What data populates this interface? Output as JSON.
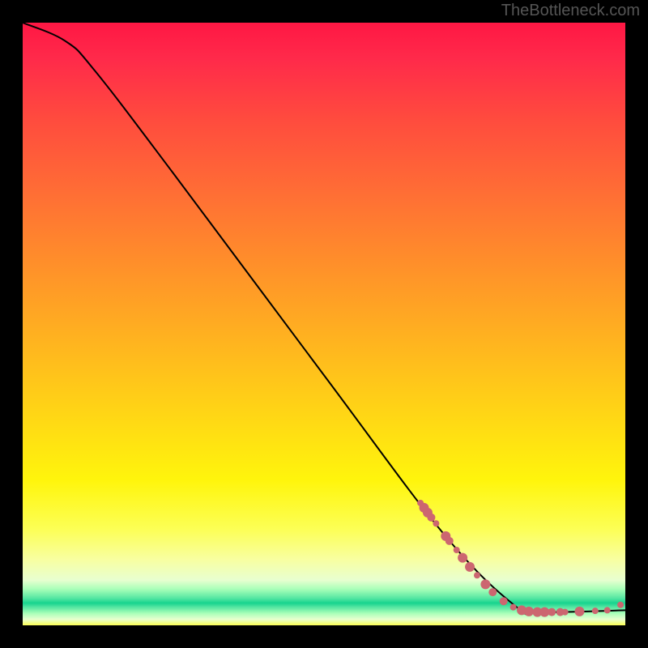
{
  "attribution": "TheBottleneck.com",
  "chart_data": {
    "type": "line",
    "title": "",
    "xlabel": "",
    "ylabel": "",
    "xlim": [
      0,
      100
    ],
    "ylim": [
      0,
      100
    ],
    "curve": [
      {
        "x": 0,
        "y": 100
      },
      {
        "x": 7,
        "y": 97
      },
      {
        "x": 12,
        "y": 92
      },
      {
        "x": 25,
        "y": 75
      },
      {
        "x": 50,
        "y": 41.5
      },
      {
        "x": 70,
        "y": 15
      },
      {
        "x": 82,
        "y": 3
      },
      {
        "x": 86,
        "y": 2.2
      },
      {
        "x": 100,
        "y": 2.5
      }
    ],
    "markers": [
      {
        "x": 66.0,
        "y": 20.3,
        "r": 4
      },
      {
        "x": 66.6,
        "y": 19.5,
        "r": 6
      },
      {
        "x": 67.2,
        "y": 18.7,
        "r": 6
      },
      {
        "x": 67.8,
        "y": 17.9,
        "r": 5
      },
      {
        "x": 68.6,
        "y": 16.9,
        "r": 4
      },
      {
        "x": 70.2,
        "y": 14.8,
        "r": 6
      },
      {
        "x": 70.8,
        "y": 14.0,
        "r": 5
      },
      {
        "x": 72.0,
        "y": 12.5,
        "r": 4
      },
      {
        "x": 73.0,
        "y": 11.2,
        "r": 6
      },
      {
        "x": 74.2,
        "y": 9.7,
        "r": 6
      },
      {
        "x": 75.4,
        "y": 8.3,
        "r": 4
      },
      {
        "x": 76.8,
        "y": 6.8,
        "r": 6
      },
      {
        "x": 78.0,
        "y": 5.5,
        "r": 5
      },
      {
        "x": 79.8,
        "y": 4.0,
        "r": 5
      },
      {
        "x": 81.4,
        "y": 3.0,
        "r": 4
      },
      {
        "x": 82.8,
        "y": 2.5,
        "r": 6
      },
      {
        "x": 84.0,
        "y": 2.3,
        "r": 6
      },
      {
        "x": 85.4,
        "y": 2.2,
        "r": 6
      },
      {
        "x": 86.6,
        "y": 2.2,
        "r": 6
      },
      {
        "x": 87.8,
        "y": 2.2,
        "r": 5
      },
      {
        "x": 89.2,
        "y": 2.2,
        "r": 5
      },
      {
        "x": 90.0,
        "y": 2.2,
        "r": 4
      },
      {
        "x": 92.4,
        "y": 2.3,
        "r": 6
      },
      {
        "x": 95.0,
        "y": 2.4,
        "r": 4
      },
      {
        "x": 97.0,
        "y": 2.5,
        "r": 4
      },
      {
        "x": 99.2,
        "y": 3.4,
        "r": 4
      }
    ],
    "background": {
      "type": "vertical-gradient",
      "stops": [
        {
          "pos": 0.0,
          "color": "#ff1744"
        },
        {
          "pos": 0.5,
          "color": "#ffc400"
        },
        {
          "pos": 0.8,
          "color": "#fff833"
        },
        {
          "pos": 0.96,
          "color": "#17d48e"
        },
        {
          "pos": 1.0,
          "color": "#fcff55"
        }
      ]
    }
  }
}
